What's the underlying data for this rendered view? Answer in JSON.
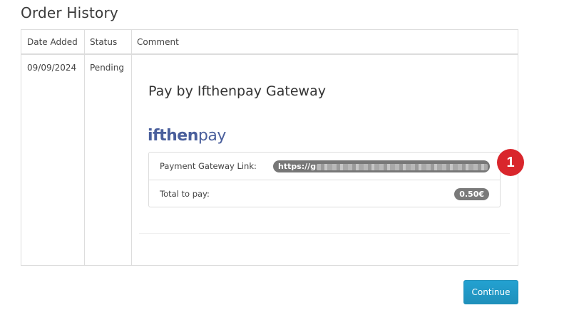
{
  "page": {
    "title": "Order History"
  },
  "table": {
    "headers": {
      "date_added": "Date Added",
      "status": "Status",
      "comment": "Comment"
    },
    "rows": [
      {
        "date_added": "09/09/2024",
        "status": "Pending"
      }
    ]
  },
  "gateway": {
    "title": "Pay by Ifthenpay Gateway",
    "logo": {
      "bold": "ifthen",
      "light": "pay"
    },
    "link_label": "Payment Gateway Link:",
    "link_value": "https://g",
    "total_label": "Total to pay:",
    "total_value": "0.50€"
  },
  "annotation": {
    "marker": "1",
    "color": "#d9262c"
  },
  "actions": {
    "continue_label": "Continue"
  },
  "colors": {
    "accent": "#229ac8",
    "pill": "#777777"
  }
}
